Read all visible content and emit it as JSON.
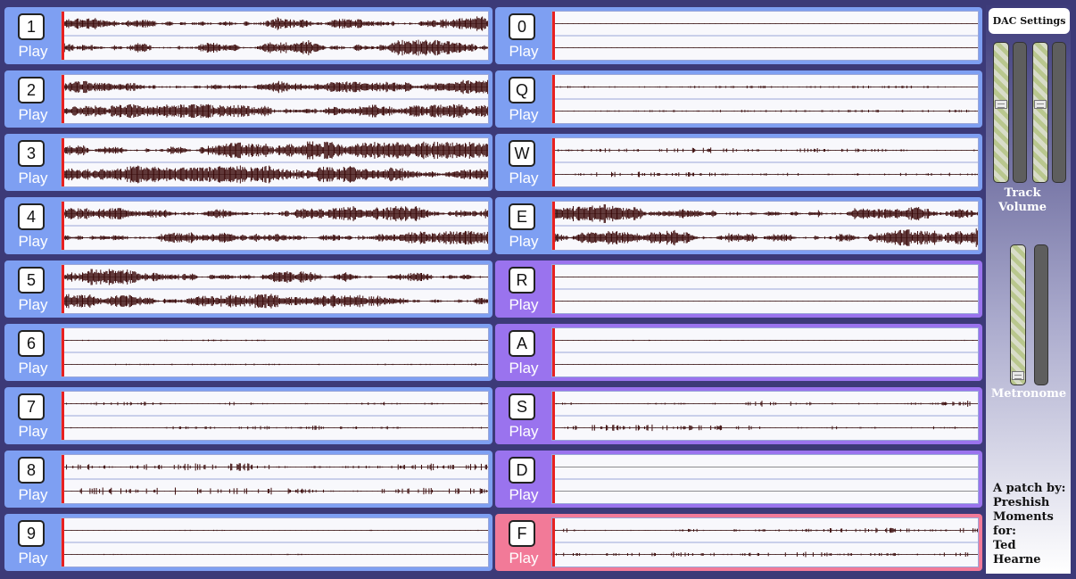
{
  "colors": {
    "blue": "#7e9ff2",
    "purple": "#9a73ee",
    "pink": "#f27a98",
    "playhead": "#e82020",
    "waveform": "#3a0808"
  },
  "tracks": [
    {
      "key": "1",
      "play": "Play",
      "color": "blue",
      "level": 0.85,
      "seed": 11
    },
    {
      "key": "2",
      "play": "Play",
      "color": "blue",
      "level": 0.75,
      "seed": 12
    },
    {
      "key": "3",
      "play": "Play",
      "color": "blue",
      "level": 0.95,
      "seed": 13
    },
    {
      "key": "4",
      "play": "Play",
      "color": "blue",
      "level": 0.8,
      "seed": 14
    },
    {
      "key": "5",
      "play": "Play",
      "color": "blue",
      "level": 0.85,
      "seed": 15
    },
    {
      "key": "6",
      "play": "Play",
      "color": "blue",
      "level": 0.1,
      "seed": 16
    },
    {
      "key": "7",
      "play": "Play",
      "color": "blue",
      "level": 0.25,
      "seed": 17
    },
    {
      "key": "8",
      "play": "Play",
      "color": "blue",
      "level": 0.4,
      "seed": 18
    },
    {
      "key": "9",
      "play": "Play",
      "color": "blue",
      "level": 0.08,
      "seed": 19
    },
    {
      "key": "0",
      "play": "Play",
      "color": "blue",
      "level": 0.04,
      "seed": 20
    },
    {
      "key": "Q",
      "play": "Play",
      "color": "blue",
      "level": 0.15,
      "seed": 21
    },
    {
      "key": "W",
      "play": "Play",
      "color": "blue",
      "level": 0.3,
      "seed": 22
    },
    {
      "key": "E",
      "play": "Play",
      "color": "blue",
      "level": 1.0,
      "seed": 23
    },
    {
      "key": "R",
      "play": "Play",
      "color": "purple",
      "level": 0.04,
      "seed": 24
    },
    {
      "key": "A",
      "play": "Play",
      "color": "purple",
      "level": 0.06,
      "seed": 25
    },
    {
      "key": "S",
      "play": "Play",
      "color": "purple",
      "level": 0.35,
      "seed": 26
    },
    {
      "key": "D",
      "play": "Play",
      "color": "purple",
      "level": 0.0,
      "seed": 27
    },
    {
      "key": "F",
      "play": "Play",
      "color": "pink",
      "level": 0.3,
      "seed": 28
    }
  ],
  "sidebar": {
    "dac_label": "DAC Settings",
    "track_volume_label": "Track Volume",
    "metronome_label": "Metronome",
    "track_volume_level": 0.7,
    "metronome_level": 0.05,
    "credit_lines": [
      "A patch by:",
      "Preshish",
      "Moments",
      "for:",
      "Ted",
      "Hearne"
    ]
  }
}
